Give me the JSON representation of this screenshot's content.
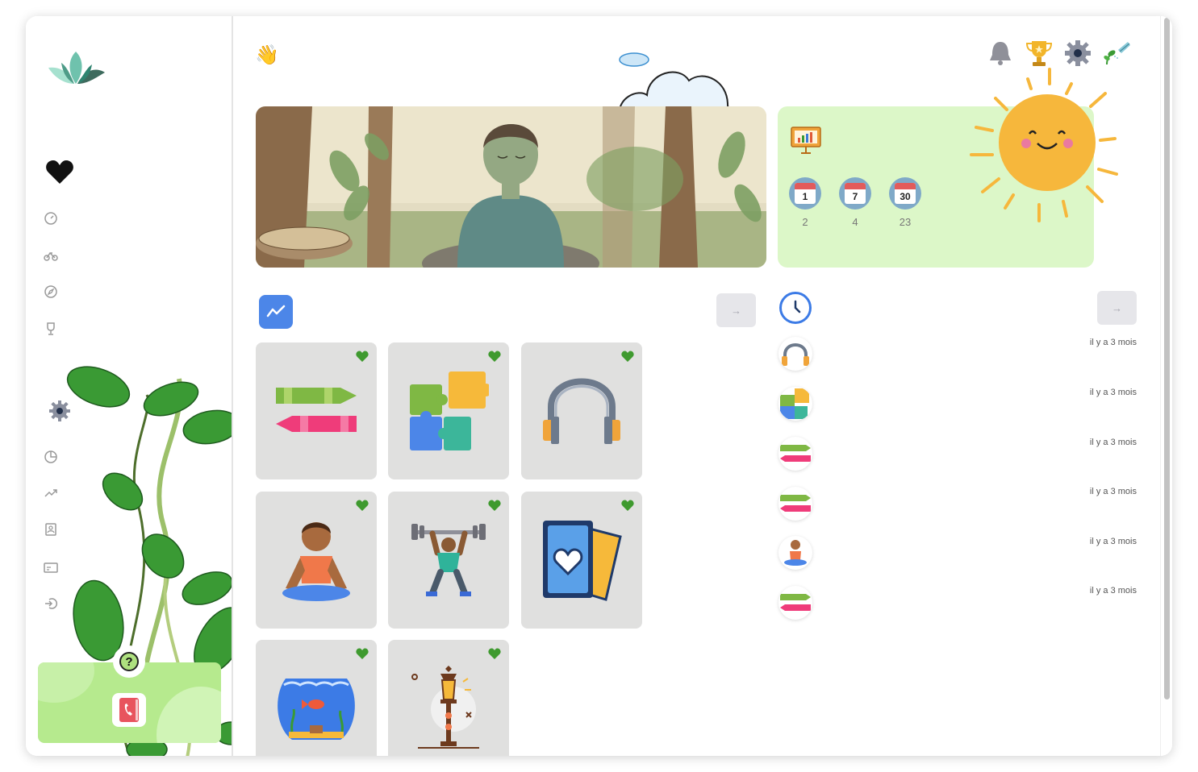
{
  "header": {
    "greeting_icon": "waving-hand-emoji",
    "greeting_text": "👋",
    "icons": [
      "bell-icon",
      "trophy-icon",
      "gear-icon",
      "plant-watering-icon"
    ]
  },
  "sidebar": {
    "items": [
      {
        "name": "dashboard",
        "icon": "gauge-icon"
      },
      {
        "name": "activities",
        "icon": "bike-icon"
      },
      {
        "name": "explore",
        "icon": "compass-icon"
      },
      {
        "name": "trophies",
        "icon": "trophy-icon"
      },
      {
        "name": "statistics",
        "icon": "pie-chart-icon"
      },
      {
        "name": "progress",
        "icon": "trend-up-icon"
      },
      {
        "name": "contacts",
        "icon": "contact-card-icon"
      },
      {
        "name": "subscription",
        "icon": "credit-card-icon"
      },
      {
        "name": "logout",
        "icon": "logout-icon"
      }
    ],
    "help_symbol": "?"
  },
  "stats": {
    "periods": [
      {
        "day": "1",
        "count": "2"
      },
      {
        "day": "7",
        "count": "4"
      },
      {
        "day": "30",
        "count": "23"
      }
    ]
  },
  "activities": {
    "arrow": "→",
    "tiles": [
      {
        "name": "crayons"
      },
      {
        "name": "puzzle"
      },
      {
        "name": "headphones"
      },
      {
        "name": "meditation"
      },
      {
        "name": "weightlifting"
      },
      {
        "name": "cards"
      },
      {
        "name": "aquarium"
      },
      {
        "name": "lamp"
      }
    ]
  },
  "history": {
    "arrow": "→",
    "items": [
      {
        "icon": "headphones-icon",
        "time": "il y a 3 mois"
      },
      {
        "icon": "puzzle-icon",
        "time": "il y a 3 mois"
      },
      {
        "icon": "crayons-icon",
        "time": "il y a 3 mois"
      },
      {
        "icon": "crayons-icon",
        "time": "il y a 3 mois"
      },
      {
        "icon": "meditation-icon",
        "time": "il y a 3 mois"
      },
      {
        "icon": "crayons-icon",
        "time": "il y a 3 mois"
      }
    ]
  },
  "colors": {
    "accent_blue": "#4c86e8",
    "stats_bg": "#dcf7c8",
    "help_bg": "#b6ea8e",
    "heart_green": "#3f9a2f",
    "tile_bg": "#e0e0df"
  }
}
